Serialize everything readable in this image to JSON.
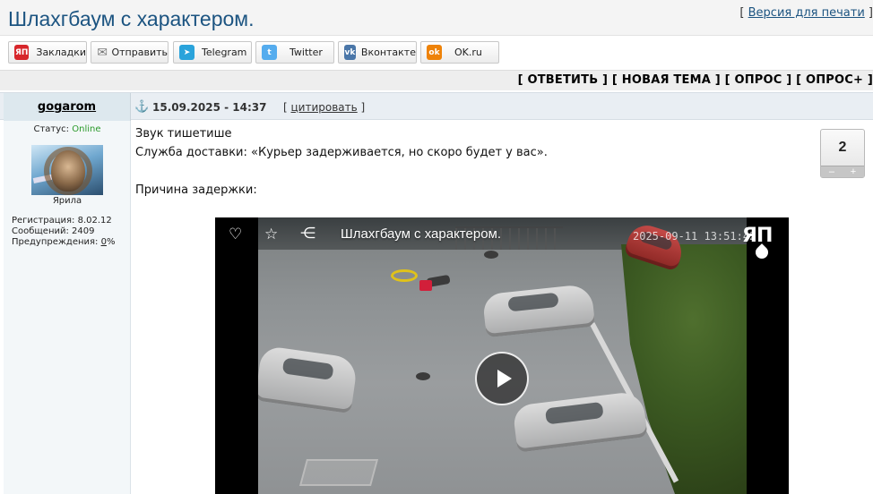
{
  "topic": {
    "title": "Шлахгбаум с характером.",
    "print_prefix": "[",
    "print_label": "Версия для печати",
    "print_suffix": "]"
  },
  "share": [
    {
      "label": "Закладки",
      "icon": "yap-icon",
      "icon_text": "ЯП",
      "color": "#d7262b"
    },
    {
      "label": "Отправить",
      "icon": "mail-icon",
      "icon_text": "✉",
      "color": "#8a8a8a"
    },
    {
      "label": "Telegram",
      "icon": "telegram-icon",
      "icon_text": "➤",
      "color": "#2aa3db"
    },
    {
      "label": "Twitter",
      "icon": "twitter-icon",
      "icon_text": "t",
      "color": "#55acee"
    },
    {
      "label": "Вконтакте",
      "icon": "vk-icon",
      "icon_text": "vk",
      "color": "#4a76a8"
    },
    {
      "label": "OK.ru",
      "icon": "ok-icon",
      "icon_text": "ok",
      "color": "#ee8208"
    }
  ],
  "actions": {
    "reply": "[ ОТВЕТИТЬ ]",
    "new_topic": "[ НОВАЯ ТЕМА ]",
    "poll": "[ ОПРОС ]",
    "poll_plus": "[ ОПРОС+ ]"
  },
  "post": {
    "author": "gogarom",
    "datetime": "15.09.2025 - 14:37",
    "quote_open": "[",
    "quote_label": "цитировать",
    "quote_close": "]",
    "lines": [
      "Звук тишетише",
      "Служба доставки: «Курьер задерживается, но скоро будет у вас».",
      "Причина задержки:"
    ],
    "rating": "2",
    "rating_minus": "–",
    "rating_plus": "+"
  },
  "profile": {
    "status_label": "Статус:",
    "status_value": "Online",
    "nick_title": "Ярила",
    "registration": "Регистрация: 8.02.12",
    "messages": "Сообщений: 2409",
    "warnings_label": "Предупреждения:",
    "warnings_value": "0",
    "warnings_suffix": "%"
  },
  "video": {
    "title": "Шлахгбаум с характером.",
    "timestamp": "2025-09-11 13:51:42",
    "logo": "ЯП",
    "icons": [
      "heart-icon",
      "star-icon",
      "share-icon",
      "play-icon"
    ]
  },
  "colors": {
    "title": "#1c5481",
    "online": "#2b9a2b",
    "header_bg": "#e9eef3"
  }
}
